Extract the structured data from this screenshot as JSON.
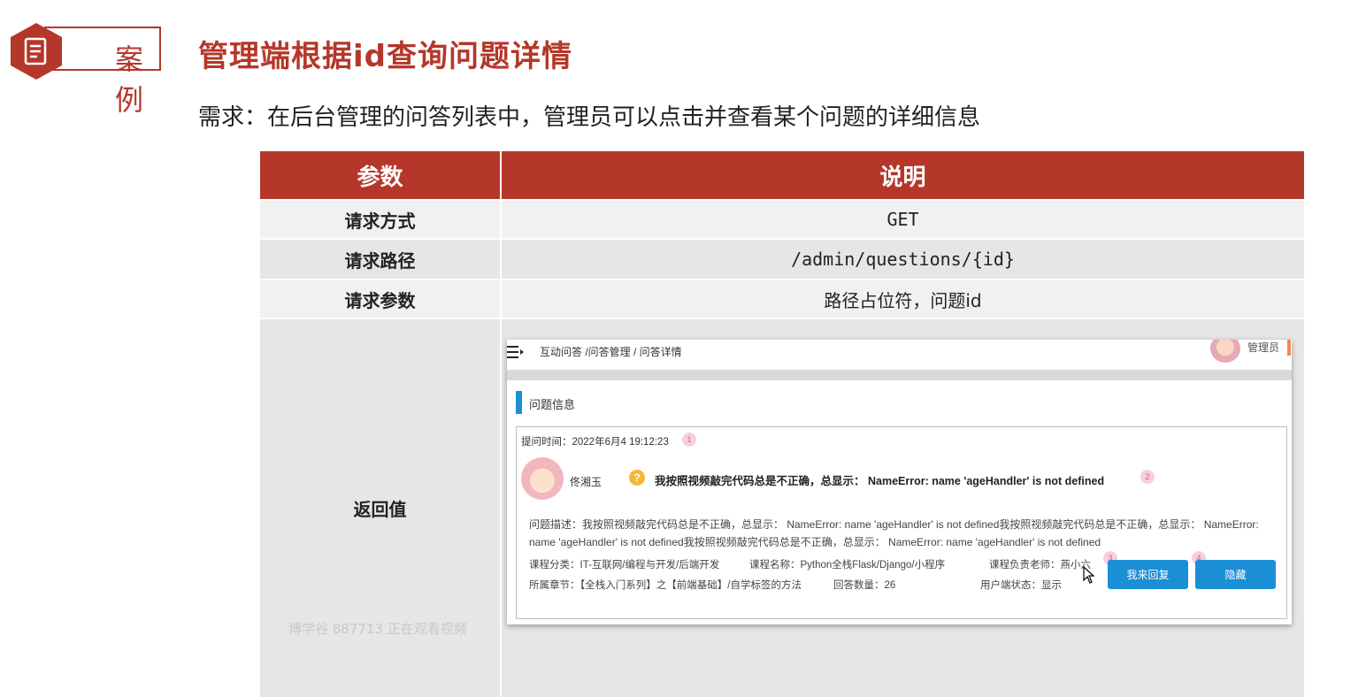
{
  "header": {
    "case_label": "案例",
    "title": "管理端根据id查询问题详情",
    "requirement": "需求：在后台管理的问答列表中，管理员可以点击并查看某个问题的详细信息"
  },
  "table": {
    "col_headers": [
      "参数",
      "说明"
    ],
    "rows": [
      {
        "param": "请求方式",
        "value": "GET"
      },
      {
        "param": "请求路径",
        "value": "/admin/questions/{id}"
      },
      {
        "param": "请求参数",
        "value": "路径占位符，问题id"
      },
      {
        "param": "返回值",
        "value": ""
      }
    ]
  },
  "watermark": "博学谷 887713 正在观看视频",
  "screenshot": {
    "breadcrumb": "互动问答 /问答管理 / 问答详情",
    "admin_name": "管理员",
    "section_title": "问题信息",
    "ask_time": "提问时间：2022年6月4 19:12:23",
    "user_name": "佟湘玉",
    "question_title": "我按照视频敲完代码总是不正确，总显示： NameError: name 'ageHandler' is not defined",
    "description": "问题描述：我按照视频敲完代码总是不正确，总显示： NameError: name 'ageHandler' is not defined我按照视频敲完代码总是不正确，总显示： NameError: name 'ageHandler' is not defined我按照视频敲完代码总是不正确，总显示： NameError: name 'ageHandler' is not defined",
    "course_category": "课程分类：IT-互联网/编程与开发/后端开发",
    "course_name": "课程名称：Python全栈Flask/Django/小程序",
    "teacher": "课程负责老师：燕小六",
    "chapter": "所属章节：【全栈入门系列】之【前端基础】/自学标签的方法",
    "answer_count": "回答数量：26",
    "user_status": "用户端状态：显示",
    "reply_button": "我来回复",
    "hide_button": "隐藏",
    "badges": [
      "1",
      "2",
      "3",
      "4"
    ]
  },
  "colors": {
    "brand_red": "#b5372a",
    "button_blue": "#1a8fd6"
  }
}
